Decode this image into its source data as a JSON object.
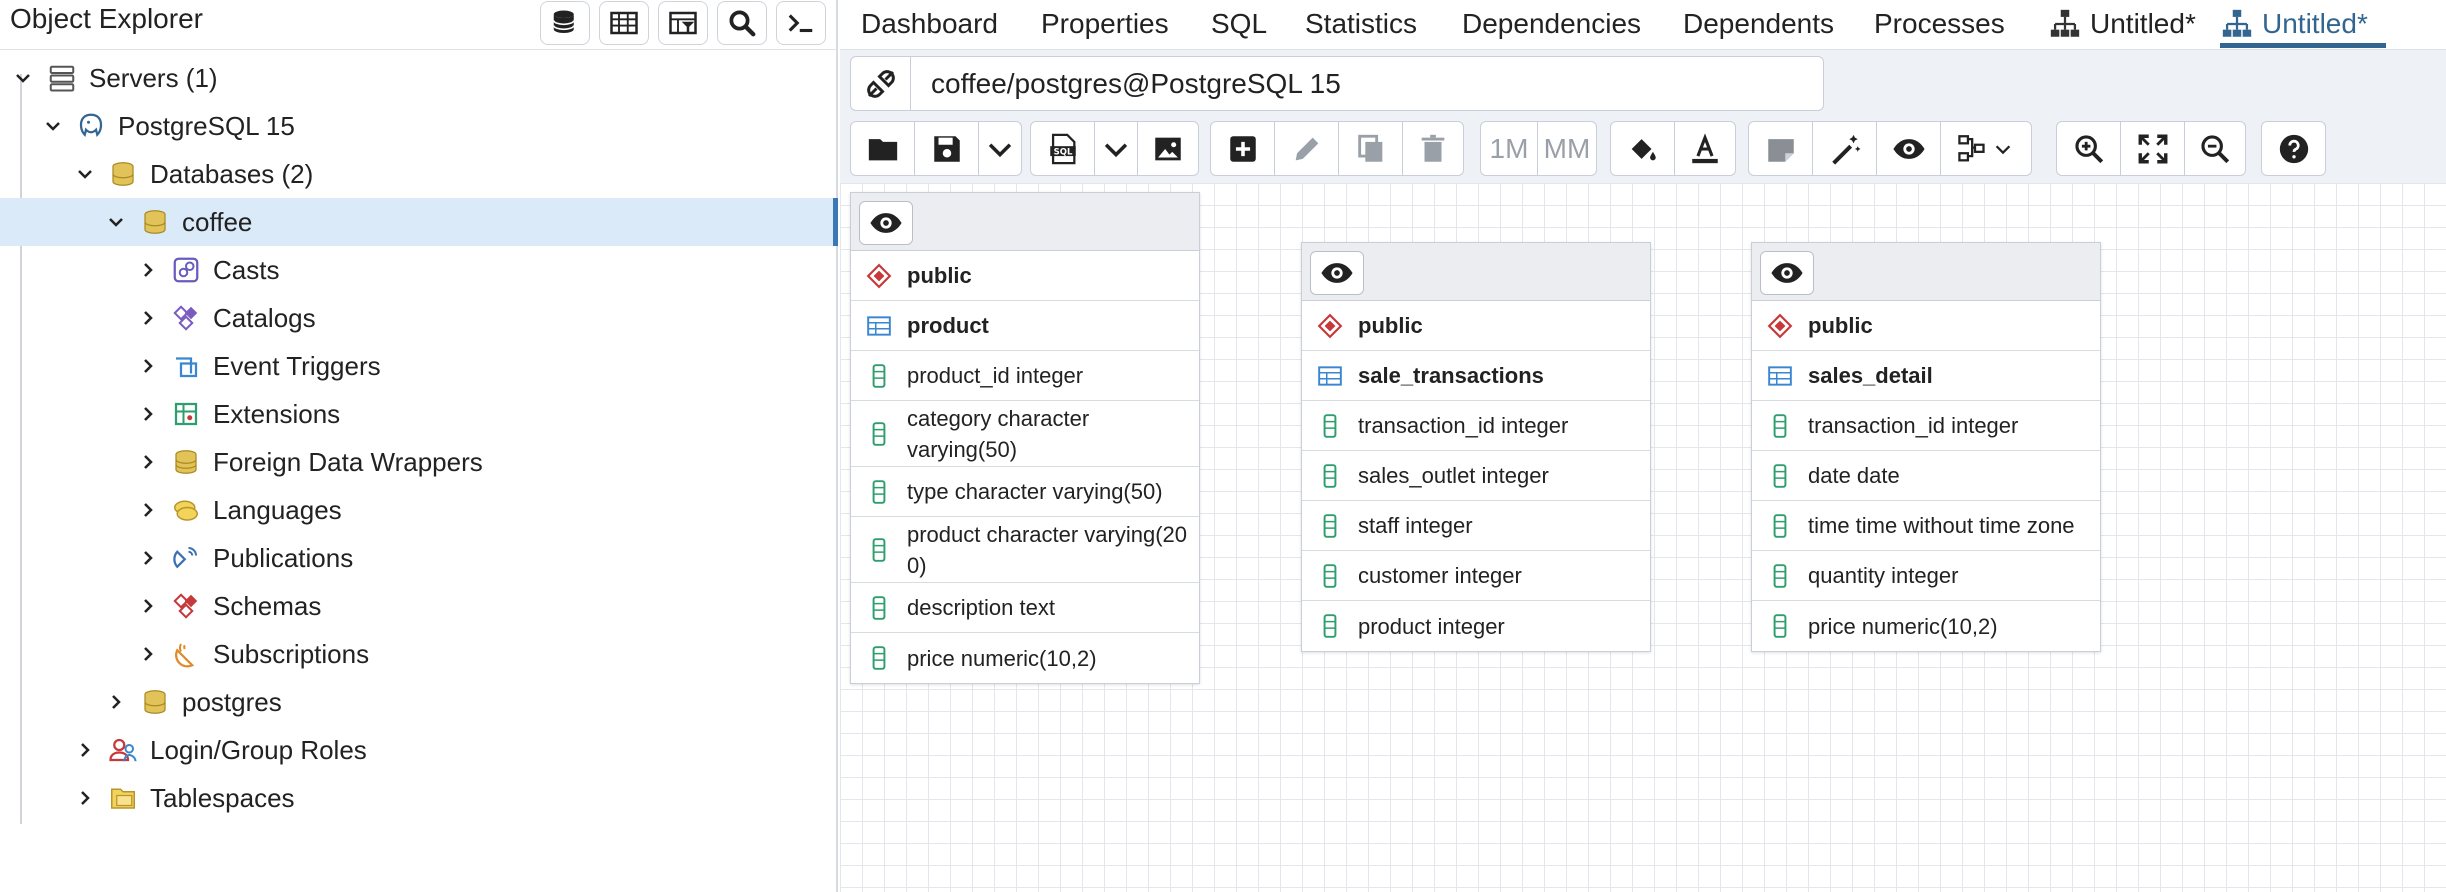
{
  "object_explorer": {
    "title": "Object Explorer",
    "toolbar": [
      {
        "icon": "database-query-icon"
      },
      {
        "icon": "table-view-icon"
      },
      {
        "icon": "filter-table-icon"
      },
      {
        "icon": "search-icon"
      },
      {
        "icon": "terminal-icon"
      }
    ],
    "tree": [
      {
        "label": "Servers (1)",
        "icon": "servers-icon",
        "expanded": true
      },
      {
        "label": "PostgreSQL 15",
        "icon": "postgresql-elephant-icon",
        "expanded": true
      },
      {
        "label": "Databases (2)",
        "icon": "databases-icon",
        "expanded": true
      },
      {
        "label": "coffee",
        "icon": "database-icon",
        "expanded": true,
        "selected": true
      },
      {
        "label": "Casts",
        "icon": "casts-icon",
        "expanded": false
      },
      {
        "label": "Catalogs",
        "icon": "catalogs-icon",
        "expanded": false
      },
      {
        "label": "Event Triggers",
        "icon": "event-triggers-icon",
        "expanded": false
      },
      {
        "label": "Extensions",
        "icon": "extensions-icon",
        "expanded": false
      },
      {
        "label": "Foreign Data Wrappers",
        "icon": "foreign-data-wrappers-icon",
        "expanded": false
      },
      {
        "label": "Languages",
        "icon": "languages-icon",
        "expanded": false
      },
      {
        "label": "Publications",
        "icon": "publications-icon",
        "expanded": false
      },
      {
        "label": "Schemas",
        "icon": "schemas-icon",
        "expanded": false
      },
      {
        "label": "Subscriptions",
        "icon": "subscriptions-icon",
        "expanded": false
      },
      {
        "label": "postgres",
        "icon": "database-icon",
        "expanded": false
      },
      {
        "label": "Login/Group Roles",
        "icon": "login-group-roles-icon",
        "expanded": false
      },
      {
        "label": "Tablespaces",
        "icon": "tablespaces-icon",
        "expanded": false
      }
    ]
  },
  "tabs": [
    {
      "label": "Dashboard"
    },
    {
      "label": "Properties"
    },
    {
      "label": "SQL"
    },
    {
      "label": "Statistics"
    },
    {
      "label": "Dependencies"
    },
    {
      "label": "Dependents"
    },
    {
      "label": "Processes"
    },
    {
      "label": "Untitled*",
      "icon": "erd-diagram-icon"
    },
    {
      "label": "Untitled*",
      "icon": "erd-diagram-icon",
      "active": true
    }
  ],
  "connection": {
    "label": "coffee/postgres@PostgreSQL 15",
    "icon": "connection-plug-icon"
  },
  "erd_toolbar": {
    "one_to_many_label": "1M",
    "many_to_many_label": "MM",
    "buttons": [
      "open-file-icon",
      "save-icon",
      "chevron-down-icon",
      "sql-file-icon",
      "chevron-down-icon",
      "image-icon",
      "add-table-icon",
      "edit-icon",
      "clone-icon",
      "delete-icon",
      "one-to-many-button",
      "many-to-many-button",
      "fill-color-icon",
      "text-color-icon",
      "note-icon",
      "auto-align-icon",
      "eye-icon",
      "layout-options-icon",
      "zoom-in-icon",
      "zoom-fit-icon",
      "zoom-out-icon",
      "help-icon"
    ],
    "colors": {
      "text_color_underline": "#222222"
    }
  },
  "erd_tables": [
    {
      "schema": "public",
      "name": "product",
      "columns": [
        "product_id integer",
        "category character varying(50)",
        "type character varying(50)",
        "product character varying(200)",
        "description text",
        "price numeric(10,2)"
      ]
    },
    {
      "schema": "public",
      "name": "sale_transactions",
      "columns": [
        "transaction_id integer",
        "sales_outlet integer",
        "staff integer",
        "customer integer",
        "product integer"
      ]
    },
    {
      "schema": "public",
      "name": "sales_detail",
      "columns": [
        "transaction_id integer",
        "date date",
        "time time without time zone",
        "quantity integer",
        "price numeric(10,2)"
      ]
    }
  ],
  "colors": {
    "accent": "#326690",
    "selection": "#dbeaf8",
    "schema_icon": "#c7383a",
    "table_icon": "#3b86d1",
    "column_icon": "#2f9e6e"
  }
}
